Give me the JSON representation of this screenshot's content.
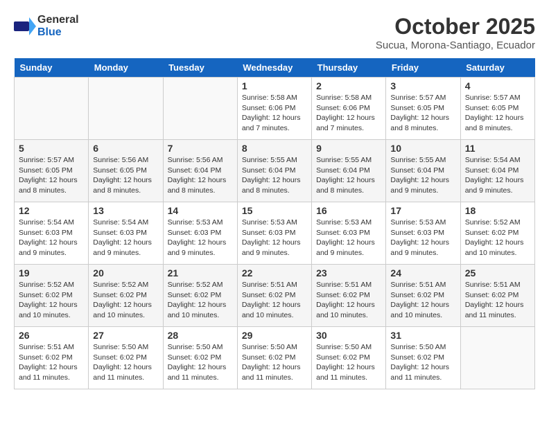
{
  "logo": {
    "general": "General",
    "blue": "Blue"
  },
  "title": "October 2025",
  "subtitle": "Sucua, Morona-Santiago, Ecuador",
  "days_of_week": [
    "Sunday",
    "Monday",
    "Tuesday",
    "Wednesday",
    "Thursday",
    "Friday",
    "Saturday"
  ],
  "weeks": [
    [
      {
        "day": "",
        "info": ""
      },
      {
        "day": "",
        "info": ""
      },
      {
        "day": "",
        "info": ""
      },
      {
        "day": "1",
        "info": "Sunrise: 5:58 AM\nSunset: 6:06 PM\nDaylight: 12 hours\nand 7 minutes."
      },
      {
        "day": "2",
        "info": "Sunrise: 5:58 AM\nSunset: 6:06 PM\nDaylight: 12 hours\nand 7 minutes."
      },
      {
        "day": "3",
        "info": "Sunrise: 5:57 AM\nSunset: 6:05 PM\nDaylight: 12 hours\nand 8 minutes."
      },
      {
        "day": "4",
        "info": "Sunrise: 5:57 AM\nSunset: 6:05 PM\nDaylight: 12 hours\nand 8 minutes."
      }
    ],
    [
      {
        "day": "5",
        "info": "Sunrise: 5:57 AM\nSunset: 6:05 PM\nDaylight: 12 hours\nand 8 minutes."
      },
      {
        "day": "6",
        "info": "Sunrise: 5:56 AM\nSunset: 6:05 PM\nDaylight: 12 hours\nand 8 minutes."
      },
      {
        "day": "7",
        "info": "Sunrise: 5:56 AM\nSunset: 6:04 PM\nDaylight: 12 hours\nand 8 minutes."
      },
      {
        "day": "8",
        "info": "Sunrise: 5:55 AM\nSunset: 6:04 PM\nDaylight: 12 hours\nand 8 minutes."
      },
      {
        "day": "9",
        "info": "Sunrise: 5:55 AM\nSunset: 6:04 PM\nDaylight: 12 hours\nand 8 minutes."
      },
      {
        "day": "10",
        "info": "Sunrise: 5:55 AM\nSunset: 6:04 PM\nDaylight: 12 hours\nand 9 minutes."
      },
      {
        "day": "11",
        "info": "Sunrise: 5:54 AM\nSunset: 6:04 PM\nDaylight: 12 hours\nand 9 minutes."
      }
    ],
    [
      {
        "day": "12",
        "info": "Sunrise: 5:54 AM\nSunset: 6:03 PM\nDaylight: 12 hours\nand 9 minutes."
      },
      {
        "day": "13",
        "info": "Sunrise: 5:54 AM\nSunset: 6:03 PM\nDaylight: 12 hours\nand 9 minutes."
      },
      {
        "day": "14",
        "info": "Sunrise: 5:53 AM\nSunset: 6:03 PM\nDaylight: 12 hours\nand 9 minutes."
      },
      {
        "day": "15",
        "info": "Sunrise: 5:53 AM\nSunset: 6:03 PM\nDaylight: 12 hours\nand 9 minutes."
      },
      {
        "day": "16",
        "info": "Sunrise: 5:53 AM\nSunset: 6:03 PM\nDaylight: 12 hours\nand 9 minutes."
      },
      {
        "day": "17",
        "info": "Sunrise: 5:53 AM\nSunset: 6:03 PM\nDaylight: 12 hours\nand 9 minutes."
      },
      {
        "day": "18",
        "info": "Sunrise: 5:52 AM\nSunset: 6:02 PM\nDaylight: 12 hours\nand 10 minutes."
      }
    ],
    [
      {
        "day": "19",
        "info": "Sunrise: 5:52 AM\nSunset: 6:02 PM\nDaylight: 12 hours\nand 10 minutes."
      },
      {
        "day": "20",
        "info": "Sunrise: 5:52 AM\nSunset: 6:02 PM\nDaylight: 12 hours\nand 10 minutes."
      },
      {
        "day": "21",
        "info": "Sunrise: 5:52 AM\nSunset: 6:02 PM\nDaylight: 12 hours\nand 10 minutes."
      },
      {
        "day": "22",
        "info": "Sunrise: 5:51 AM\nSunset: 6:02 PM\nDaylight: 12 hours\nand 10 minutes."
      },
      {
        "day": "23",
        "info": "Sunrise: 5:51 AM\nSunset: 6:02 PM\nDaylight: 12 hours\nand 10 minutes."
      },
      {
        "day": "24",
        "info": "Sunrise: 5:51 AM\nSunset: 6:02 PM\nDaylight: 12 hours\nand 10 minutes."
      },
      {
        "day": "25",
        "info": "Sunrise: 5:51 AM\nSunset: 6:02 PM\nDaylight: 12 hours\nand 11 minutes."
      }
    ],
    [
      {
        "day": "26",
        "info": "Sunrise: 5:51 AM\nSunset: 6:02 PM\nDaylight: 12 hours\nand 11 minutes."
      },
      {
        "day": "27",
        "info": "Sunrise: 5:50 AM\nSunset: 6:02 PM\nDaylight: 12 hours\nand 11 minutes."
      },
      {
        "day": "28",
        "info": "Sunrise: 5:50 AM\nSunset: 6:02 PM\nDaylight: 12 hours\nand 11 minutes."
      },
      {
        "day": "29",
        "info": "Sunrise: 5:50 AM\nSunset: 6:02 PM\nDaylight: 12 hours\nand 11 minutes."
      },
      {
        "day": "30",
        "info": "Sunrise: 5:50 AM\nSunset: 6:02 PM\nDaylight: 12 hours\nand 11 minutes."
      },
      {
        "day": "31",
        "info": "Sunrise: 5:50 AM\nSunset: 6:02 PM\nDaylight: 12 hours\nand 11 minutes."
      },
      {
        "day": "",
        "info": ""
      }
    ]
  ]
}
